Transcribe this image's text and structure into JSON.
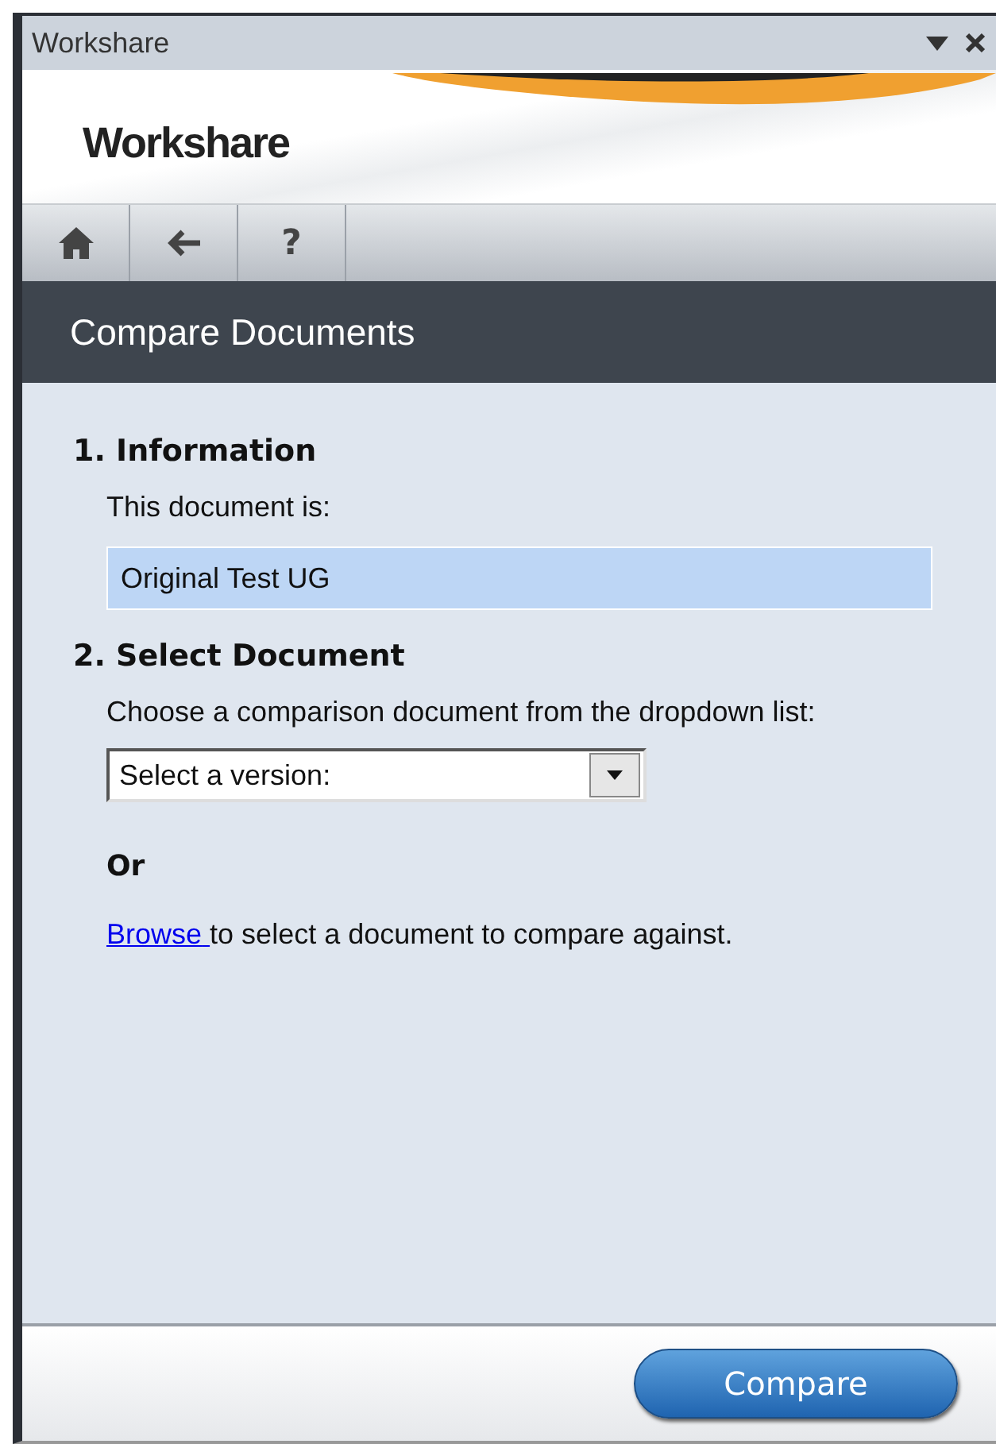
{
  "window": {
    "title": "Workshare"
  },
  "banner": {
    "logo": "Workshare"
  },
  "toolbar": {
    "help": "?"
  },
  "header": {
    "title": "Compare Documents"
  },
  "section_1": {
    "heading": "1. Information",
    "label": "This document is:",
    "value": "Original Test UG"
  },
  "section_2": {
    "heading": "2. Select Document",
    "label": "Choose a comparison document from the dropdown list:",
    "dropdown": {
      "value": "Select a version:"
    },
    "or": "Or",
    "browse_link": "Browse",
    "browse_text": "to select a document to compare against."
  },
  "footer": {
    "button": "Compare"
  }
}
